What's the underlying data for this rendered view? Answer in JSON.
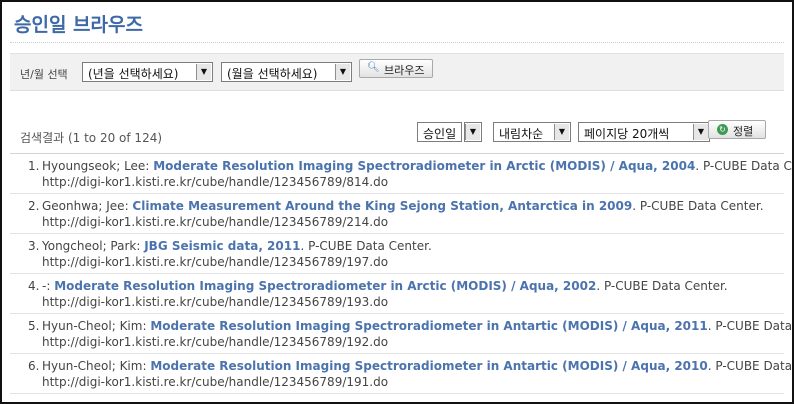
{
  "page": {
    "title": "승인일 브라우즈"
  },
  "filter": {
    "label": "년/월 선택",
    "year_select": "(년을 선택하세요)",
    "month_select": "(월을 선택하세요)",
    "browse_button": "브라우즈"
  },
  "results_header": {
    "count_text": "검색결과 (1 to 20 of 124)",
    "sort_field": "승인일",
    "sort_order": "내림차순",
    "per_page": "페이지당 20개씩",
    "sort_button": "정렬"
  },
  "results": [
    {
      "num": "1.",
      "authors": "Hyoungseok; Lee: ",
      "title": "Moderate Resolution Imaging Spectroradiometer in Arctic (MODIS) / Aqua, 2004",
      "publisher": ". P-CUBE Data Center.",
      "url": "http://digi-kor1.kisti.re.kr/cube/handle/123456789/814.do"
    },
    {
      "num": "2.",
      "authors": "Geonhwa; Jee: ",
      "title": "Climate Measurement Around the King Sejong Station, Antarctica in 2009",
      "publisher": ". P-CUBE Data Center.",
      "url": "http://digi-kor1.kisti.re.kr/cube/handle/123456789/214.do"
    },
    {
      "num": "3.",
      "authors": "Yongcheol; Park: ",
      "title": "JBG Seismic data, 2011",
      "publisher": ". P-CUBE Data Center.",
      "url": "http://digi-kor1.kisti.re.kr/cube/handle/123456789/197.do"
    },
    {
      "num": "4.",
      "authors": "-: ",
      "title": "Moderate Resolution Imaging Spectroradiometer in Arctic (MODIS) / Aqua, 2002",
      "publisher": ". P-CUBE Data Center.",
      "url": "http://digi-kor1.kisti.re.kr/cube/handle/123456789/193.do"
    },
    {
      "num": "5.",
      "authors": "Hyun-Cheol; Kim: ",
      "title": "Moderate Resolution Imaging Spectroradiometer in Antartic (MODIS) / Aqua, 2011",
      "publisher": ". P-CUBE Data Center.",
      "url": "http://digi-kor1.kisti.re.kr/cube/handle/123456789/192.do"
    },
    {
      "num": "6.",
      "authors": "Hyun-Cheol; Kim: ",
      "title": "Moderate Resolution Imaging Spectroradiometer in Antartic (MODIS) / Aqua, 2010",
      "publisher": ". P-CUBE Data Center.",
      "url": "http://digi-kor1.kisti.re.kr/cube/handle/123456789/191.do"
    }
  ],
  "icons": {
    "browse": "magnifier-icon",
    "sort": "refresh-icon",
    "dropdown": "dropdown-arrow-icon"
  },
  "colors": {
    "title": "#3d6aa6",
    "link": "#4b73ad",
    "filter_bg": "#f1f1f1",
    "sort_icon": "#3e9a52"
  }
}
